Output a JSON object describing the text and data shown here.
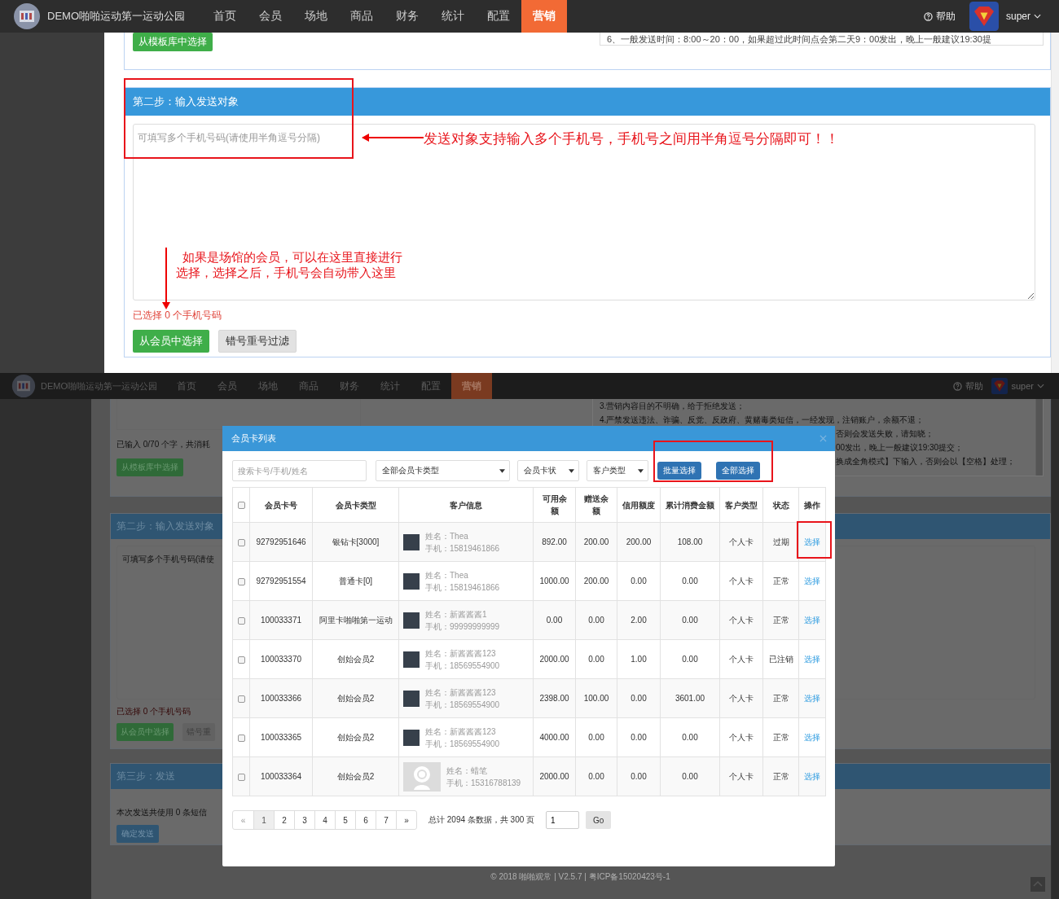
{
  "top_screen": {
    "nav": {
      "logo_text": "DEMO啪啪运动第一运动公园",
      "items": [
        {
          "label": "首页",
          "selected": false
        },
        {
          "label": "会员",
          "selected": false
        },
        {
          "label": "场地",
          "selected": false
        },
        {
          "label": "商品",
          "selected": false
        },
        {
          "label": "财务",
          "selected": false
        },
        {
          "label": "统计",
          "selected": false
        },
        {
          "label": "配置",
          "selected": false
        },
        {
          "label": "营销",
          "selected": true
        }
      ],
      "help": "帮助",
      "user": "super"
    },
    "template_button": "从模板库中选择",
    "notice_line": "6、一般发送时间：8:00～20：00，如果超过此时间点会第二天9：00发出，晚上一般建议19:30提",
    "step2": {
      "title": "第二步：输入发送对象",
      "placeholder": "可填写多个手机号码(请使用半角逗号分隔)",
      "selected_text": "已选择 0 个手机号码",
      "buttons": [
        {
          "label": "从会员中选择",
          "kind": "primary"
        },
        {
          "label": "错号重号过滤",
          "kind": "default"
        }
      ]
    },
    "annotations": [
      "发送对象支持输入多个手机号，手机号之间用半角逗号分隔即可！！",
      "如果是场馆的会员，可以在这里直接进行选择，选择之后，手机号会自动带入这里"
    ]
  },
  "bottom_screen": {
    "nav": {
      "logo_text": "DEMO啪啪运动第一运动公园",
      "items": [
        {
          "label": "首页",
          "selected": false
        },
        {
          "label": "会员",
          "selected": false
        },
        {
          "label": "场地",
          "selected": false
        },
        {
          "label": "商品",
          "selected": false
        },
        {
          "label": "财务",
          "selected": false
        },
        {
          "label": "统计",
          "selected": false
        },
        {
          "label": "配置",
          "selected": false
        },
        {
          "label": "营销",
          "selected": true
        }
      ],
      "help": "帮助",
      "user": "super"
    },
    "background": {
      "char_count": "已输入 0/70 个字，共消耗",
      "template_button": "从模板库中选择",
      "notes": [
        "3.营销内容目的不明确，给于拒绝发送；",
        "4.严禁发送违法、诈骗、反党、反政府、黄赌毒类短信，一经发现，注销账户，余额不退；"
      ],
      "notes_cut": [
        "否则会发送失败，请知晓；",
        "00发出，晚上一般建议19:30提交；",
        "换成全角模式】下输入，否则会以【空格】处理；"
      ],
      "step2_title": "第二步：输入发送对象",
      "placeholder": "可填写多个手机号码(请使",
      "selected_text": "已选择 0 个手机号码",
      "buttons": [
        {
          "label": "从会员中选择",
          "kind": "primary"
        },
        {
          "label": "错号重",
          "kind": "default"
        }
      ],
      "step3_title": "第三步：发送",
      "usage_text": "本次发送共使用 0 条短信",
      "send_button": "确定发送",
      "footer": "© 2018 啪啪观常 | V2.5.7 | 粤ICP备15020423号-1"
    },
    "modal": {
      "title": "会员卡列表",
      "search_placeholder": "搜索卡号/手机/姓名",
      "filters": [
        "全部会员卡类型",
        "会员卡状",
        "客户类型"
      ],
      "actions": [
        "批量选择",
        "全部选择"
      ],
      "table": {
        "select_all_checked": false,
        "columns": [
          "会员卡号",
          "会员卡类型",
          "客户信息",
          "可用余额",
          "赠送余额",
          "信用额度",
          "累计消费金额",
          "客户类型",
          "状态",
          "操作"
        ],
        "rows": [
          {
            "checked": false,
            "card_no": "92792951646",
            "card_type": "银钻卡[3000]",
            "kind": "photo",
            "name": "姓名：Thea",
            "phone": "手机：15819461866",
            "balance": "892.00",
            "bonus": "200.00",
            "credit": "200.00",
            "total_spent": "108.00",
            "customer_type": "个人卡",
            "status": "过期",
            "action": "选择"
          },
          {
            "checked": false,
            "card_no": "92792951554",
            "card_type": "普通卡[0]",
            "kind": "photo",
            "name": "姓名：Thea",
            "phone": "手机：15819461866",
            "balance": "1000.00",
            "bonus": "200.00",
            "credit": "0.00",
            "total_spent": "0.00",
            "customer_type": "个人卡",
            "status": "正常",
            "action": "选择"
          },
          {
            "checked": false,
            "card_no": "100033371",
            "card_type": "阿里卡啪啪第一运动",
            "kind": "photo",
            "name": "姓名：新酱酱酱1",
            "phone": "手机：99999999999",
            "balance": "0.00",
            "bonus": "0.00",
            "credit": "2.00",
            "total_spent": "0.00",
            "customer_type": "个人卡",
            "status": "正常",
            "action": "选择"
          },
          {
            "checked": false,
            "card_no": "100033370",
            "card_type": "创始会员2",
            "kind": "photo",
            "name": "姓名：新酱酱酱123",
            "phone": "手机：18569554900",
            "balance": "2000.00",
            "bonus": "0.00",
            "credit": "1.00",
            "total_spent": "0.00",
            "customer_type": "个人卡",
            "status": "已注销",
            "action": "选择"
          },
          {
            "checked": false,
            "card_no": "100033366",
            "card_type": "创始会员2",
            "kind": "photo",
            "name": "姓名：新酱酱酱123",
            "phone": "手机：18569554900",
            "balance": "2398.00",
            "bonus": "100.00",
            "credit": "0.00",
            "total_spent": "3601.00",
            "customer_type": "个人卡",
            "status": "正常",
            "action": "选择"
          },
          {
            "checked": false,
            "card_no": "100033365",
            "card_type": "创始会员2",
            "kind": "photo",
            "name": "姓名：新酱酱酱123",
            "phone": "手机：18569554900",
            "balance": "4000.00",
            "bonus": "0.00",
            "credit": "0.00",
            "total_spent": "0.00",
            "customer_type": "个人卡",
            "status": "正常",
            "action": "选择"
          },
          {
            "checked": false,
            "card_no": "100033364",
            "card_type": "创始会员2",
            "kind": "default",
            "name": "姓名：蜡笔",
            "phone": "手机：15316788139",
            "balance": "2000.00",
            "bonus": "0.00",
            "credit": "0.00",
            "total_spent": "0.00",
            "customer_type": "个人卡",
            "status": "正常",
            "action": "选择"
          }
        ]
      },
      "pagination": {
        "prev": "«",
        "pages": [
          {
            "label": "1",
            "selected": true
          },
          {
            "label": "2",
            "selected": false
          },
          {
            "label": "3",
            "selected": false
          },
          {
            "label": "4",
            "selected": false
          },
          {
            "label": "5",
            "selected": false
          },
          {
            "label": "6",
            "selected": false
          },
          {
            "label": "7",
            "selected": false
          }
        ],
        "next": "»",
        "summary": "总计 2094 条数据，共 300 页",
        "page_input": "1",
        "go": "Go"
      }
    }
  }
}
